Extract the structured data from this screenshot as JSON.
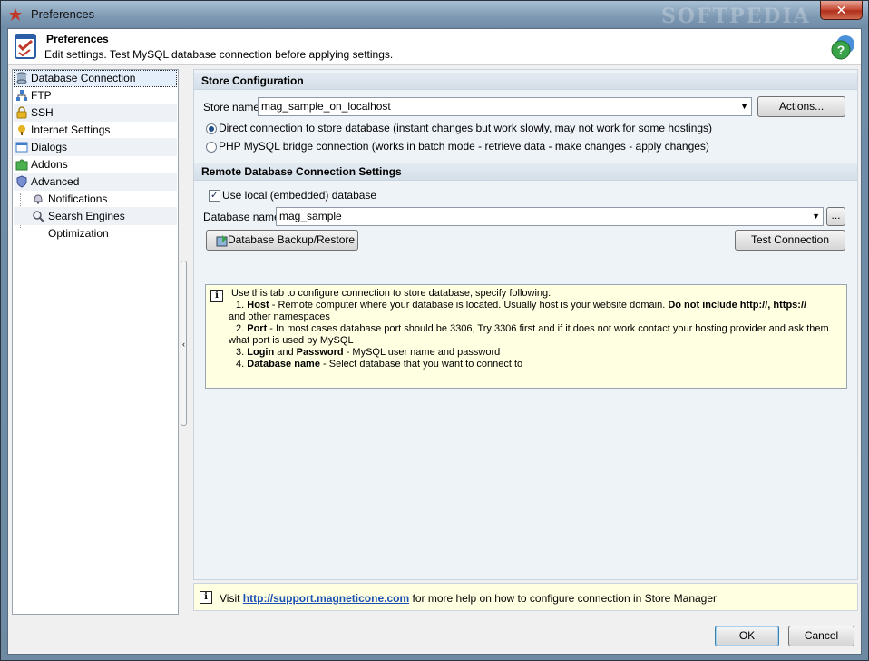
{
  "window": {
    "title": "Preferences",
    "watermark": "SOFTPEDIA",
    "close_glyph": "✕"
  },
  "header": {
    "title": "Preferences",
    "subtitle": "Edit settings. Test MySQL database connection before applying settings.",
    "help_glyph": "?"
  },
  "nav": {
    "items": [
      {
        "label": "Database Connection",
        "icon": "database-icon"
      },
      {
        "label": "FTP",
        "icon": "network-icon"
      },
      {
        "label": "SSH",
        "icon": "lock-icon"
      },
      {
        "label": "Internet Settings",
        "icon": "internet-icon"
      },
      {
        "label": "Dialogs",
        "icon": "window-icon"
      },
      {
        "label": "Addons",
        "icon": "puzzle-icon"
      },
      {
        "label": "Advanced",
        "icon": "shield-icon"
      },
      {
        "label": "Notifications",
        "icon": "bell-icon"
      },
      {
        "label": "Searsh Engines Optimization",
        "icon": "magnifier-icon"
      }
    ]
  },
  "splitter_glyph": "‹",
  "store_config": {
    "header": "Store Configuration",
    "store_name_label": "Store name",
    "store_name_value": "mag_sample_on_localhost",
    "actions_button": "Actions...",
    "radio_direct": "Direct connection to store database (instant changes but work slowly, may not work for some hostings)",
    "radio_bridge": "PHP MySQL bridge connection (works in batch mode - retrieve data - make changes - apply changes)",
    "selected": "direct"
  },
  "remote": {
    "header": "Remote Database Connection Settings",
    "use_local_label": "Use local (embedded) database",
    "use_local_checked": true,
    "check_glyph": "✓",
    "db_name_label": "Database name",
    "db_name_value": "mag_sample",
    "browse_button": "...",
    "backup_button": "Database Backup/Restore",
    "test_button": "Test Connection"
  },
  "info": {
    "icon_glyph": "i",
    "intro": "Use this tab to configure connection to store database, specify following:",
    "item1_num": "1.",
    "item1_bold": "Host",
    "item1_text": " - Remote computer where your database is located. Usually host is your website domain. ",
    "item1_bold2": "Do not include http://, https://",
    "item1_cont": "and other namespaces",
    "item2_num": "2.",
    "item2_bold": "Port",
    "item2_text": " - In most cases database port should be 3306, Try 3306 first and if it does not work contact your hosting provider and ask them",
    "item2_cont": "what port is used by MySQL",
    "item3_num": "3.",
    "item3_bold": "Login",
    "item3_and": " and ",
    "item3_bold2": "Password",
    "item3_text": " - MySQL user name and password",
    "item4_num": "4.",
    "item4_bold": "Database name",
    "item4_text": " - Select database that you want to connect to"
  },
  "footer": {
    "visit": "Visit",
    "link": "http://support.magneticone.com",
    "rest": "for more help on how to configure connection in Store Manager"
  },
  "buttons": {
    "ok": "OK",
    "cancel": "Cancel"
  },
  "colors": {
    "link": "#1a4fb3",
    "info_bg": "#ffffe1",
    "selection": "#e5eefb"
  }
}
